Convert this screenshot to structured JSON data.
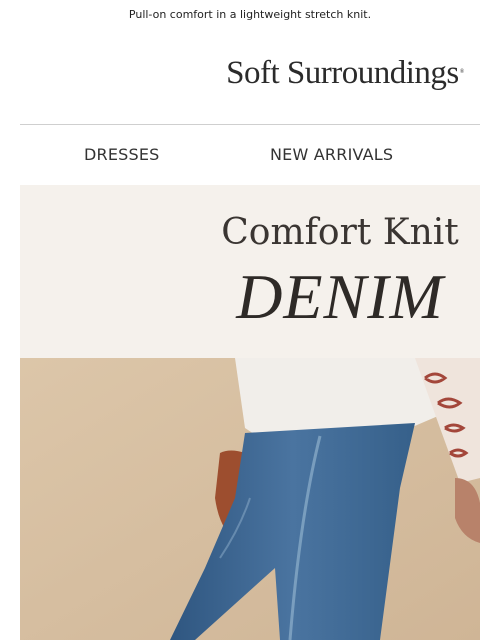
{
  "preheader": {
    "text": "Pull-on comfort in a lightweight stretch knit."
  },
  "brand": {
    "logo_text": "Soft Surroundings",
    "registered_mark": "®"
  },
  "nav": {
    "items": [
      {
        "label": "DRESSES"
      },
      {
        "label": "NEW ARRIVALS"
      }
    ]
  },
  "hero": {
    "title": "Comfort Knit",
    "subtitle": "DENIM"
  },
  "photo": {
    "subject": "model wearing blue knit denim pants and a white top with red patterned sleeve"
  },
  "colors": {
    "hero_band": "#f5f1ec",
    "denim": "#3f6690",
    "background_wall": "#d9c2a4",
    "top": "#f1eeea",
    "sleeve_pattern": "#a3463a"
  }
}
